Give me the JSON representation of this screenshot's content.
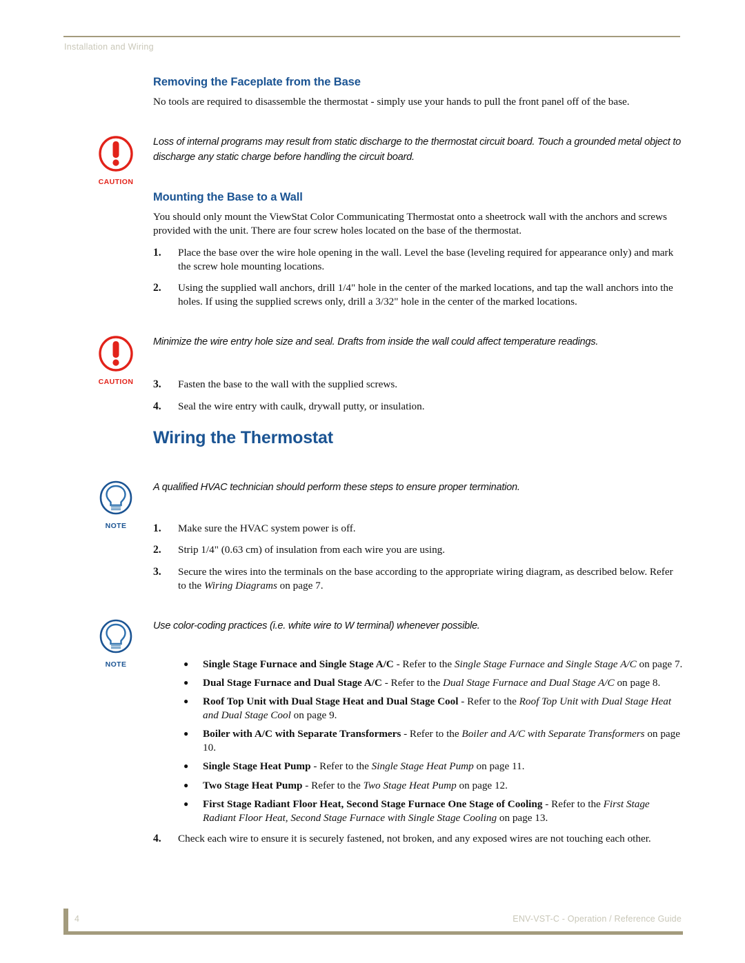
{
  "header": {
    "running_head": "Installation and Wiring",
    "rule_color": "#a39b7d",
    "text_color": "#c9c7b8"
  },
  "theme": {
    "heading_blue": "#1b5493",
    "caution_red": "#e2231a",
    "note_blue": "#1b5493",
    "rule_tan": "#a39b7d"
  },
  "sections": {
    "faceplate": {
      "heading": "Removing the Faceplate from the Base",
      "paragraph": "No tools are required to disassemble the thermostat - simply use your hands to pull the front panel off of the base."
    },
    "caution_1": {
      "icon_name": "caution-icon",
      "icon_label": "CAUTION",
      "text": "Loss of internal programs may result from static discharge to the thermostat circuit board. Touch a grounded metal object to discharge any static charge before handling the circuit board."
    },
    "mounting": {
      "heading": "Mounting the Base to a Wall",
      "paragraph": "You should only mount the ViewStat Color Communicating Thermostat onto a sheetrock wall with the anchors and screws provided with the unit. There are four screw holes located on the base of the thermostat.",
      "steps": [
        {
          "number": "1.",
          "text": "Place the base over the wire hole opening in the wall. Level the base (leveling required for appearance only) and mark the screw hole mounting locations."
        },
        {
          "number": "2.",
          "text": "Using the supplied wall anchors, drill 1/4\" hole in the center of the marked locations, and tap the wall anchors into the holes. If using the supplied screws only, drill a 3/32\" hole in the center of the marked locations."
        }
      ]
    },
    "caution_2": {
      "icon_name": "caution-icon",
      "icon_label": "CAUTION",
      "text": "Minimize the wire entry hole size and seal. Drafts from inside the wall could affect temperature readings."
    },
    "mounting_steps_cont": [
      {
        "number": "3.",
        "text": "Fasten the base to the wall with the supplied screws."
      },
      {
        "number": "4.",
        "text": "Seal the wire entry with caulk, drywall putty, or insulation."
      }
    ],
    "wiring": {
      "heading": "Wiring the Thermostat"
    },
    "note_1": {
      "icon_name": "note-icon",
      "icon_label": "NOTE",
      "text": "A qualified HVAC technician should perform these steps to ensure proper termination."
    },
    "wiring_steps": [
      {
        "number": "1.",
        "text": "Make sure the HVAC system power is off."
      },
      {
        "number": "2.",
        "text": "Strip 1/4\" (0.63 cm) of insulation from each wire you are using."
      }
    ],
    "wiring_step_3": {
      "number": "3.",
      "text_before": "Secure the wires into the terminals on the base according to the appropriate wiring diagram, as described below. Refer to the ",
      "italic_ref": "Wiring Diagrams",
      "text_after": " on page 7."
    },
    "note_2": {
      "icon_name": "note-icon",
      "icon_label": "NOTE",
      "text": "Use color-coding practices (i.e. white wire to W terminal) whenever possible."
    },
    "diagram_bullets": [
      {
        "bold": "Single Stage Furnace and Single Stage A/C",
        "middle": " - Refer to the ",
        "italic": "Single Stage Furnace and Single Stage A/C",
        "tail": "  on page 7."
      },
      {
        "bold": "Dual Stage Furnace and Dual Stage A/C",
        "middle": " - Refer to the ",
        "italic": "Dual Stage Furnace and Dual Stage A/C",
        "tail": "  on page 8."
      },
      {
        "bold": "Roof Top Unit with Dual Stage Heat and Dual Stage Cool",
        "middle": " - Refer to the ",
        "italic": "Roof Top Unit with Dual Stage Heat and Dual Stage Cool",
        "tail": "  on page 9."
      },
      {
        "bold": "Boiler with A/C with Separate Transformers",
        "middle": " - Refer to the ",
        "italic": "Boiler and A/C with Separate Transformers",
        "tail": "  on page 10."
      },
      {
        "bold": "Single Stage Heat Pump",
        "middle": " - Refer to the ",
        "italic": "Single Stage Heat Pump",
        "tail": "  on page 11."
      },
      {
        "bold": "Two Stage Heat Pump",
        "middle": " - Refer to the ",
        "italic": "Two Stage Heat Pump",
        "tail": "  on page 12."
      },
      {
        "bold": "First Stage Radiant Floor Heat, Second Stage Furnace One Stage of Cooling",
        "middle": " - Refer to the ",
        "italic": "First Stage Radiant Floor Heat, Second Stage Furnace with Single Stage Cooling",
        "tail": "  on page 13."
      }
    ],
    "wiring_step_4": {
      "number": "4.",
      "text": "Check each wire to ensure it is securely fastened, not broken, and any exposed wires are not touching each other."
    }
  },
  "footer": {
    "page_number": "4",
    "guide_title": "ENV-VST-C - Operation / Reference Guide"
  }
}
